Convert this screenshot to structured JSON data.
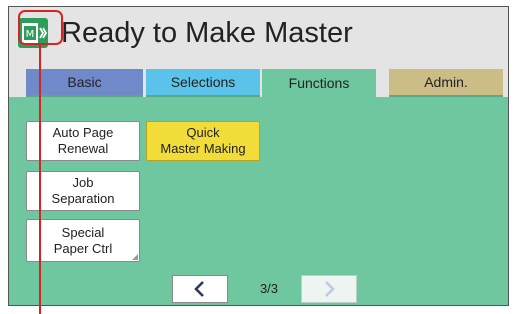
{
  "header": {
    "title": "Ready to Make Master",
    "status_icon": "master-making-icon"
  },
  "tabs": [
    {
      "label": "Basic",
      "color": "#6f89c9"
    },
    {
      "label": "Selections",
      "color": "#5bc3ea"
    },
    {
      "label": "Functions",
      "color": "#6fc7a0",
      "active": true
    },
    {
      "label": "Admin.",
      "color": "#cbbd85"
    }
  ],
  "functions": {
    "auto_page_renewal": "Auto Page\nRenewal",
    "quick_master_making": "Quick\nMaster Making",
    "job_separation": "Job\nSeparation",
    "special_paper_ctrl": "Special\nPaper Ctrl"
  },
  "pager": {
    "page": "3/3",
    "prev_icon": "chevron-left-icon",
    "next_icon": "chevron-right-icon"
  },
  "colors": {
    "panel": "#6fc7a0",
    "highlight_button": "#f2dc3a",
    "callout": "#d42424"
  }
}
